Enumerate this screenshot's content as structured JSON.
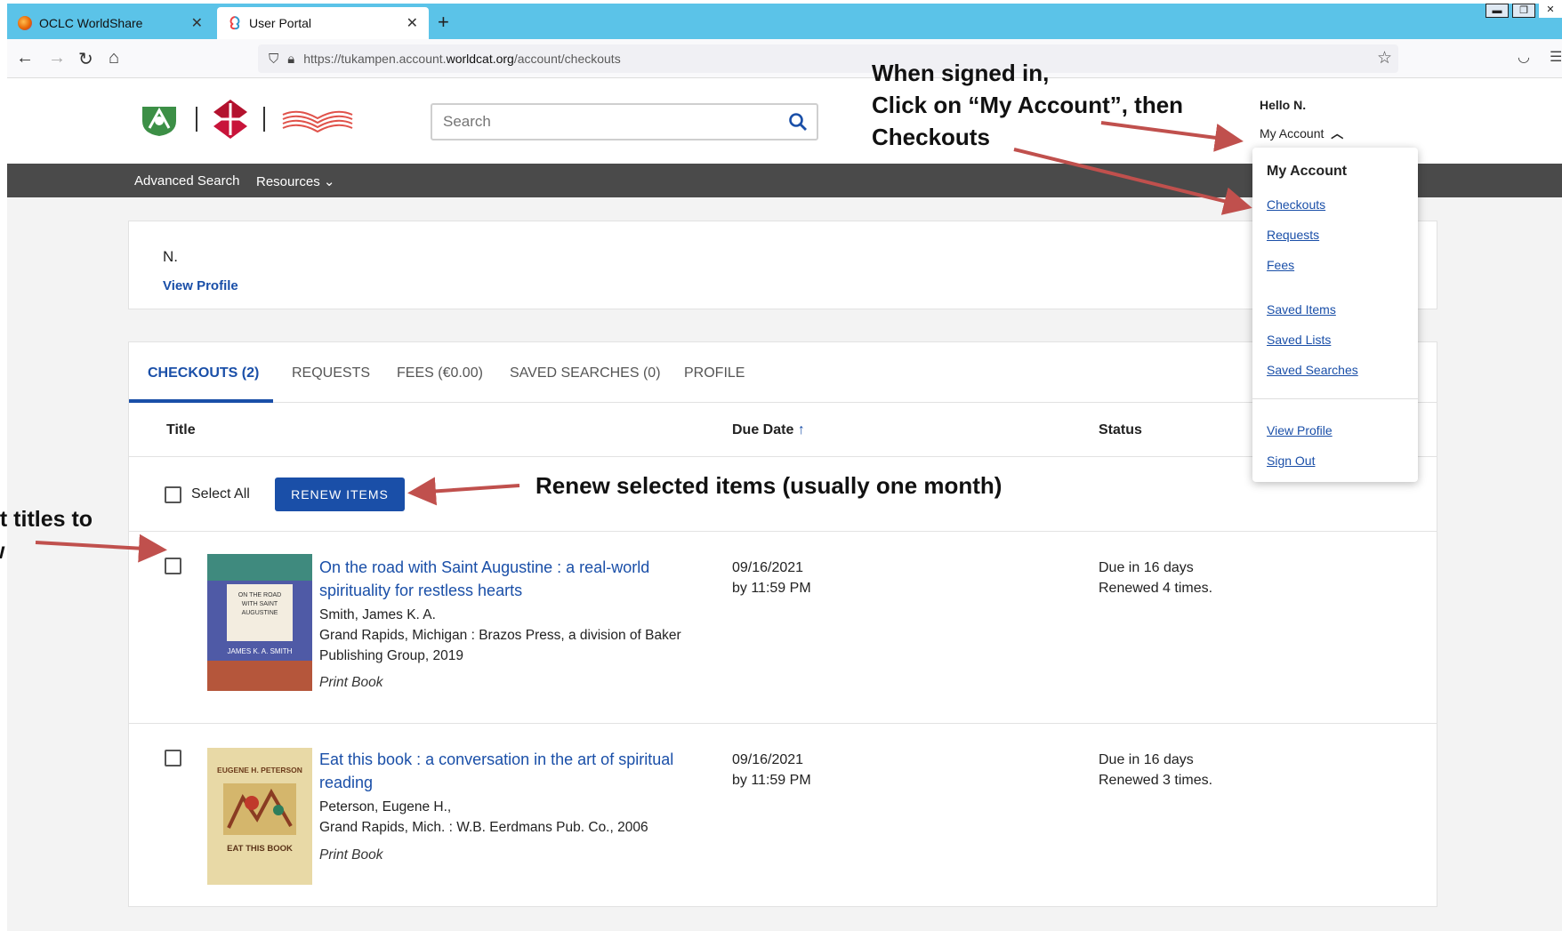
{
  "browser": {
    "tabs": [
      {
        "label": "OCLC WorldShare",
        "close": "✕"
      },
      {
        "label": "User Portal",
        "close": "✕"
      }
    ],
    "new_tab": "+",
    "url_prefix": "https://tukampen.account.",
    "url_domain": "worldcat.org",
    "url_path": "/account/checkouts"
  },
  "header": {
    "search_placeholder": "Search",
    "hello": "Hello N.",
    "my_account": "My Account"
  },
  "nav": {
    "advanced_search": "Advanced Search",
    "resources": "Resources"
  },
  "profile_card": {
    "name": "N.",
    "view_profile": "View Profile"
  },
  "account_tabs": [
    "CHECKOUTS (2)",
    "REQUESTS",
    "FEES (€0.00)",
    "SAVED SEARCHES (0)",
    "PROFILE"
  ],
  "columns": {
    "title": "Title",
    "due_date": "Due Date",
    "status": "Status"
  },
  "actions": {
    "select_all": "Select All",
    "renew_items": "RENEW ITEMS"
  },
  "items": [
    {
      "title": "On the road with Saint Augustine : a real-world spirituality for restless hearts",
      "author": "Smith, James K. A.",
      "publisher": "Grand Rapids, Michigan : Brazos Press, a division of Baker Publishing Group, 2019",
      "format": "Print Book",
      "due_date": "09/16/2021",
      "due_time": "by 11:59 PM",
      "status_due": "Due in 16 days",
      "status_renewed": "Renewed 4 times.",
      "cover_lines": [
        "ON THE ROAD",
        "WITH SAINT",
        "AUGUSTINE",
        "JAMES K. A. SMITH"
      ]
    },
    {
      "title": "Eat this book : a conversation in the art of spiritual reading",
      "author": "Peterson, Eugene H.,",
      "publisher": "Grand Rapids, Mich. : W.B. Eerdmans Pub. Co., 2006",
      "format": "Print Book",
      "due_date": "09/16/2021",
      "due_time": "by 11:59 PM",
      "status_due": "Due in 16 days",
      "status_renewed": "Renewed 3 times.",
      "cover_lines": [
        "EUGENE H. PETERSON",
        "EAT THIS BOOK"
      ]
    }
  ],
  "dropdown": {
    "heading": "My Account",
    "links": [
      "Checkouts",
      "Requests",
      "Fees",
      "Saved Items",
      "Saved Lists",
      "Saved Searches",
      "View Profile",
      "Sign Out"
    ]
  },
  "annotations": {
    "signed_in_line1": "When signed in,",
    "signed_in_line2": "Click on “My Account”, then",
    "signed_in_line3": "Checkouts",
    "renew_note": "Renew selected items (usually one month)",
    "select_line1": "ct titles to",
    "select_line2": "w"
  },
  "colors": {
    "tab_bar": "#5bc3e8",
    "link_blue": "#1a4fa8",
    "dark_nav": "#4a4a4a",
    "arrow_red": "#c0504d"
  }
}
